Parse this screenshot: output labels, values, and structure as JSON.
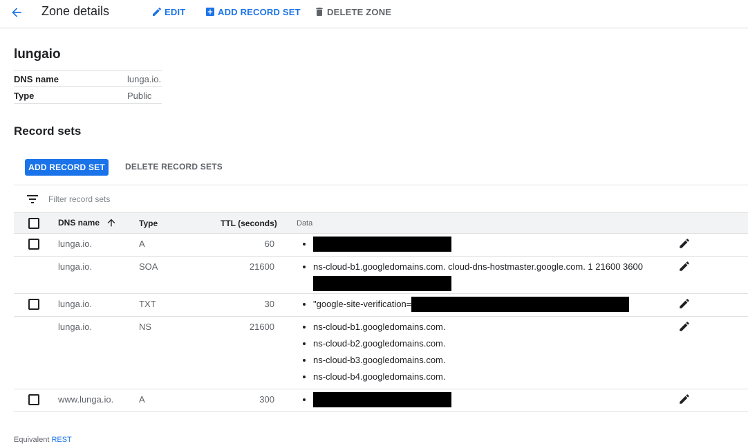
{
  "header": {
    "title": "Zone details",
    "edit_label": "EDIT",
    "add_record_label": "ADD RECORD SET",
    "delete_zone_label": "DELETE ZONE"
  },
  "zone": {
    "name": "lungaio",
    "fields": [
      {
        "key": "DNS name",
        "value": "lunga.io."
      },
      {
        "key": "Type",
        "value": "Public"
      }
    ]
  },
  "record_sets": {
    "title": "Record sets",
    "add_label": "ADD RECORD SET",
    "delete_label": "DELETE RECORD SETS",
    "filter_placeholder": "Filter record sets",
    "columns": {
      "dns_name": "DNS name",
      "type": "Type",
      "ttl": "TTL (seconds)",
      "data": "Data"
    },
    "rows": [
      {
        "dns": "lunga.io.",
        "type": "A",
        "ttl": "60"
      },
      {
        "dns": "lunga.io.",
        "type": "SOA",
        "ttl": "21600",
        "data0": "ns-cloud-b1.googledomains.com. cloud-dns-hostmaster.google.com. 1 21600 3600"
      },
      {
        "dns": "lunga.io.",
        "type": "TXT",
        "ttl": "30",
        "data0": "\"google-site-verification="
      },
      {
        "dns": "lunga.io.",
        "type": "NS",
        "ttl": "21600",
        "data": [
          "ns-cloud-b1.googledomains.com.",
          "ns-cloud-b2.googledomains.com.",
          "ns-cloud-b3.googledomains.com.",
          "ns-cloud-b4.googledomains.com."
        ]
      },
      {
        "dns": "www.lunga.io.",
        "type": "A",
        "ttl": "300"
      }
    ]
  },
  "footer": {
    "prefix": "Equivalent",
    "link": "REST"
  },
  "colors": {
    "accent": "#1a73e8",
    "redaction": "#000000",
    "header_bg": "#f1f3f4"
  }
}
